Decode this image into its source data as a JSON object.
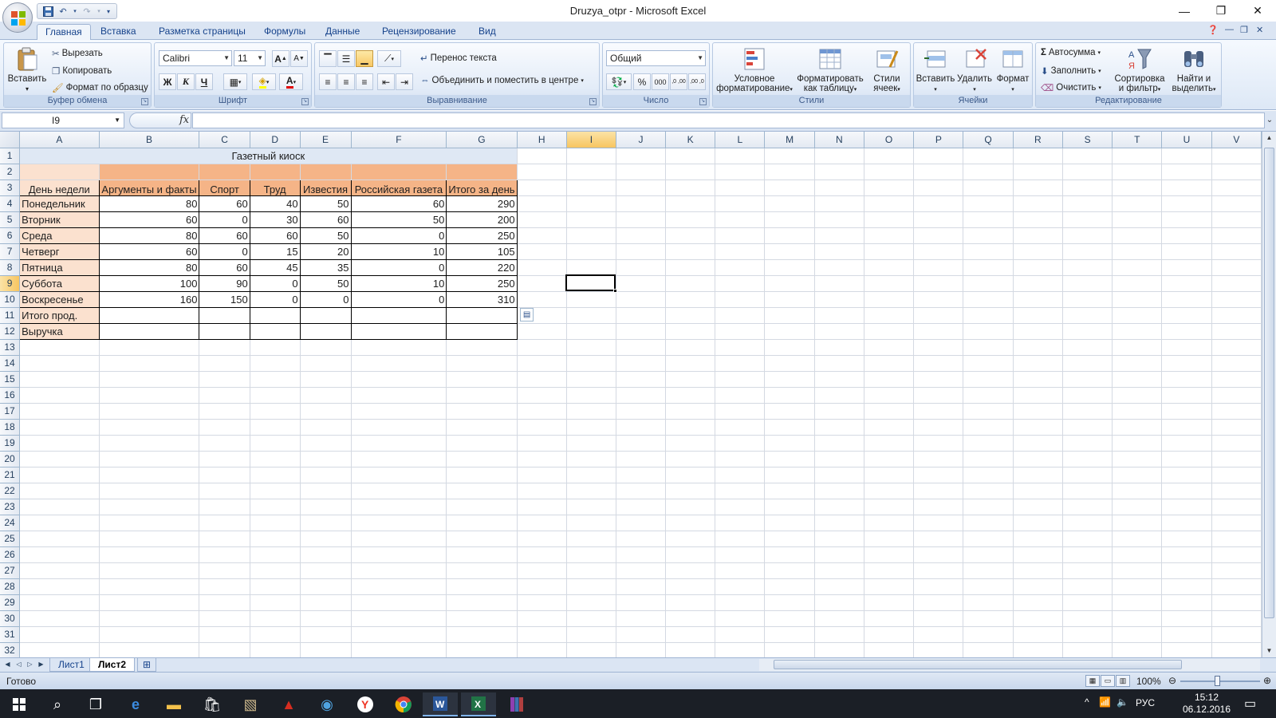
{
  "window": {
    "title": "Druzya_otpr - Microsoft Excel",
    "controls": {
      "minimize": "—",
      "restore": "❐",
      "close": "✕"
    }
  },
  "tabs": [
    "Главная",
    "Вставка",
    "Разметка страницы",
    "Формулы",
    "Данные",
    "Рецензирование",
    "Вид"
  ],
  "ribbon": {
    "clipboard": {
      "label": "Буфер обмена",
      "paste": "Вставить",
      "cut": "Вырезать",
      "copy": "Копировать",
      "format_painter": "Формат по образцу"
    },
    "font": {
      "label": "Шрифт",
      "family": "Calibri",
      "size": "11",
      "bold": "Ж",
      "italic": "К",
      "underline": "Ч",
      "grow": "A",
      "shrink": "A"
    },
    "alignment": {
      "label": "Выравнивание",
      "wrap": "Перенос текста",
      "merge": "Объединить и поместить в центре"
    },
    "number": {
      "label": "Число",
      "format": "Общий",
      "percent": "%",
      "thousands": "000",
      "inc_dec": ",0 ,00",
      "dec_dec": ",00 ,0"
    },
    "styles": {
      "label": "Стили",
      "conditional_1": "Условное",
      "conditional_2": "форматирование",
      "as_table_1": "Форматировать",
      "as_table_2": "как таблицу",
      "cell_styles_1": "Стили",
      "cell_styles_2": "ячеек"
    },
    "cells": {
      "label": "Ячейки",
      "insert": "Вставить",
      "delete": "Удалить",
      "format": "Формат"
    },
    "editing": {
      "label": "Редактирование",
      "autosum": "Автосумма",
      "fill": "Заполнить",
      "clear": "Очистить",
      "sort_1": "Сортировка",
      "sort_2": "и фильтр",
      "find_1": "Найти и",
      "find_2": "выделить"
    }
  },
  "formula_bar": {
    "name_box": "I9",
    "fx": "fx",
    "value": ""
  },
  "grid": {
    "columns": [
      "A",
      "B",
      "C",
      "D",
      "E",
      "F",
      "G",
      "H",
      "I",
      "J",
      "K",
      "L",
      "M",
      "N",
      "O",
      "P",
      "Q",
      "R",
      "S",
      "T",
      "U",
      "V"
    ],
    "row_numbers": [
      "1",
      "2",
      "3",
      "4",
      "5",
      "6",
      "7",
      "8",
      "9",
      "10",
      "11",
      "12",
      "13",
      "14",
      "15",
      "16",
      "17",
      "18",
      "19",
      "20",
      "21",
      "22",
      "23",
      "24",
      "25",
      "26",
      "27",
      "28",
      "29",
      "30",
      "31",
      "32"
    ],
    "selected_cell": "I9",
    "title": "Газетный киоск",
    "headers": [
      "День недели",
      "Аргументы и факты",
      "Спорт",
      "Труд",
      "Известия",
      "Российская газета",
      "Итого за день"
    ],
    "rows": [
      [
        "Понедельник",
        "80",
        "60",
        "40",
        "50",
        "60",
        "290"
      ],
      [
        "Вторник",
        "60",
        "0",
        "30",
        "60",
        "50",
        "200"
      ],
      [
        "Среда",
        "80",
        "60",
        "60",
        "50",
        "0",
        "250"
      ],
      [
        "Четверг",
        "60",
        "0",
        "15",
        "20",
        "10",
        "105"
      ],
      [
        "Пятница",
        "80",
        "60",
        "45",
        "35",
        "0",
        "220"
      ],
      [
        "Суббота",
        "100",
        "90",
        "0",
        "50",
        "10",
        "250"
      ],
      [
        "Воскресенье",
        "160",
        "150",
        "0",
        "0",
        "0",
        "310"
      ],
      [
        "Итого прод.",
        "",
        "",
        "",
        "",
        "",
        ""
      ],
      [
        "Выручка",
        "",
        "",
        "",
        "",
        "",
        ""
      ]
    ]
  },
  "sheets": [
    "Лист1",
    "Лист2"
  ],
  "active_sheet": "Лист2",
  "status": {
    "ready": "Готово",
    "zoom": "100%"
  },
  "taskbar": {
    "time": "15:12",
    "date": "06.12.2016",
    "lang": "РУС"
  }
}
